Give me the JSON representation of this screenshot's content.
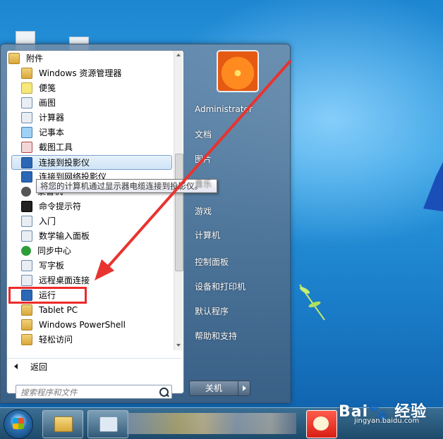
{
  "start_menu": {
    "programs": [
      {
        "label": "附件",
        "icon": "folder-icon",
        "level": "top"
      },
      {
        "label": "Windows 资源管理器",
        "icon": "explorer-icon"
      },
      {
        "label": "便笺",
        "icon": "sticky-notes-icon"
      },
      {
        "label": "画图",
        "icon": "paint-icon"
      },
      {
        "label": "计算器",
        "icon": "calculator-icon"
      },
      {
        "label": "记事本",
        "icon": "notepad-icon"
      },
      {
        "label": "截图工具",
        "icon": "snipping-tool-icon"
      },
      {
        "label": "连接到投影仪",
        "icon": "projector-icon",
        "selected": true
      },
      {
        "label": "连接到网络投影仪",
        "icon": "network-projector-icon"
      },
      {
        "label": "录音机",
        "icon": "sound-recorder-icon"
      },
      {
        "label": "命令提示符",
        "icon": "cmd-icon"
      },
      {
        "label": "入门",
        "icon": "getting-started-icon"
      },
      {
        "label": "数学输入面板",
        "icon": "math-input-icon"
      },
      {
        "label": "同步中心",
        "icon": "sync-center-icon"
      },
      {
        "label": "写字板",
        "icon": "wordpad-icon"
      },
      {
        "label": "远程桌面连接",
        "icon": "remote-desktop-icon"
      },
      {
        "label": "运行",
        "icon": "run-icon",
        "highlighted": true
      },
      {
        "label": "Tablet PC",
        "icon": "folder-icon"
      },
      {
        "label": "Windows PowerShell",
        "icon": "folder-icon"
      },
      {
        "label": "轻松访问",
        "icon": "folder-icon"
      }
    ],
    "tooltip": "将您的计算机通过显示器电缆连接到投影仪。",
    "back_label": "返回",
    "search_placeholder": "搜索程序和文件",
    "right_items": [
      {
        "label": "Administrator"
      },
      {
        "label": "文档"
      },
      {
        "label": "图片"
      },
      {
        "label": "音乐"
      },
      {
        "label": "游戏"
      },
      {
        "label": "计算机"
      },
      {
        "label": "控制面板"
      },
      {
        "label": "设备和打印机"
      },
      {
        "label": "默认程序"
      },
      {
        "label": "帮助和支持"
      }
    ],
    "shutdown_label": "关机"
  },
  "watermark": {
    "main": "Bai🐾 经验",
    "sub": "jingyan.baidu.com"
  },
  "colors": {
    "highlight_box": "#ee2a2a",
    "arrow": "#e8332f",
    "desktop": "#1f87d2"
  }
}
